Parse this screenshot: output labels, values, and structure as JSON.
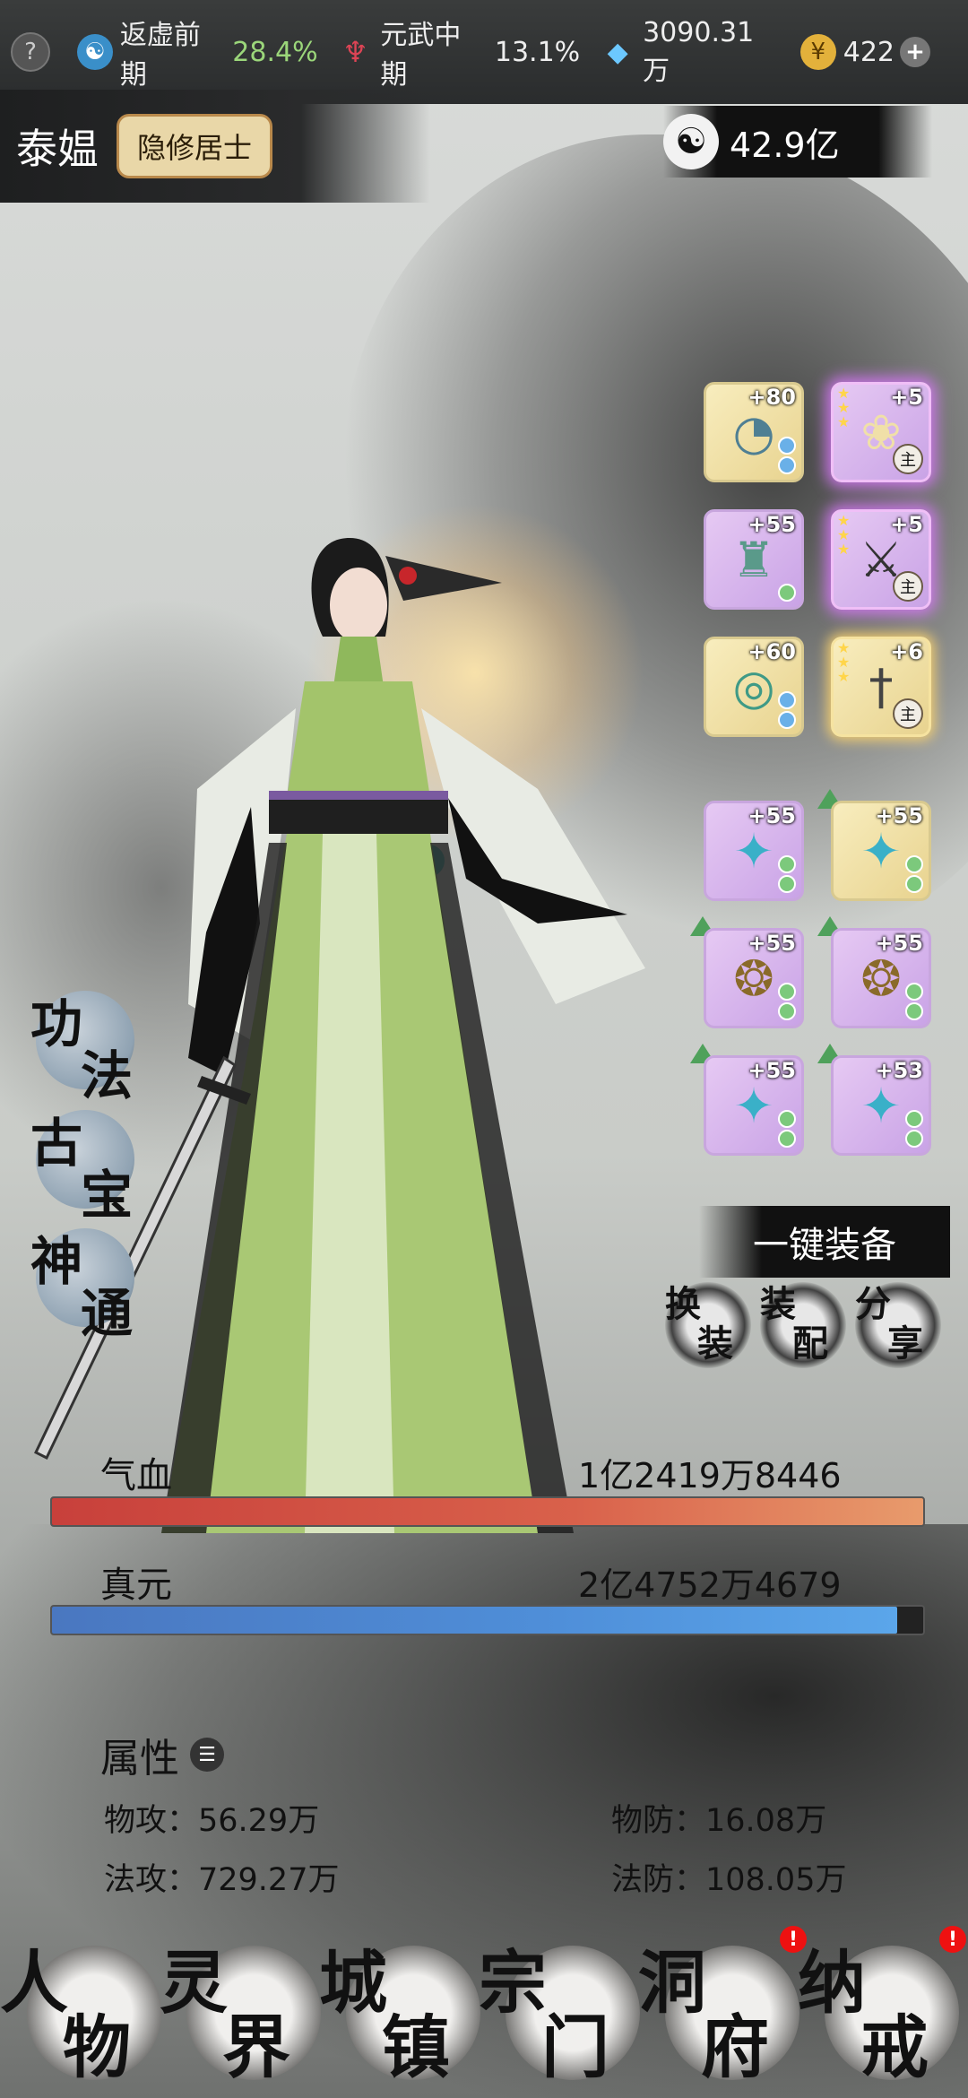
{
  "topbar": {
    "help": "?",
    "realm1": {
      "label": "返虚前期",
      "pct": "28.4%"
    },
    "realm2": {
      "label": "元武中期",
      "pct": "13.1%"
    },
    "spirit_stone": "3090.31万",
    "coins": "422"
  },
  "header": {
    "name": "泰媪",
    "title": "隐修居士",
    "power": "42.9亿"
  },
  "equipment": {
    "right_column_top": [
      {
        "level": "+80",
        "icon": "fan-icon",
        "type": "gold"
      },
      {
        "level": "+5",
        "icon": "lotus-icon",
        "type": "purple-main"
      },
      {
        "level": "+55",
        "icon": "robe-icon",
        "type": "purple"
      },
      {
        "level": "+5",
        "icon": "sword-icon",
        "type": "purple-main"
      },
      {
        "level": "+60",
        "icon": "jade-pendant-icon",
        "type": "gold"
      },
      {
        "level": "+6",
        "icon": "dagger-icon",
        "type": "gold-main"
      }
    ],
    "right_column_bottom": [
      {
        "level": "+55",
        "icon": "scroll-icon"
      },
      {
        "level": "+55",
        "icon": "scroll-icon"
      },
      {
        "level": "+55",
        "icon": "mirror-icon"
      },
      {
        "level": "+55",
        "icon": "mirror-icon"
      },
      {
        "level": "+55",
        "icon": "scroll-icon"
      },
      {
        "level": "+53",
        "icon": "scroll-icon"
      }
    ],
    "main_mark": "主"
  },
  "left_menu": [
    {
      "c1": "功",
      "c2": "法"
    },
    {
      "c1": "古",
      "c2": "宝"
    },
    {
      "c1": "神",
      "c2": "通"
    }
  ],
  "actions": {
    "one_key": "一键装备",
    "swap": {
      "c1": "换",
      "c2": "装"
    },
    "match": {
      "c1": "装",
      "c2": "配"
    },
    "share": {
      "c1": "分",
      "c2": "享"
    }
  },
  "stats": {
    "hp": {
      "label": "气血",
      "value": "1亿2419万8446",
      "fill_pct": 100
    },
    "mp": {
      "label": "真元",
      "value": "2亿4752万4679",
      "fill_pct": 97
    }
  },
  "attributes": {
    "title": "属性",
    "phys_atk": "物攻：56.29万",
    "phys_def": "物防：16.08万",
    "mag_atk": "法攻：729.27万",
    "mag_def": "法防：108.05万"
  },
  "nav": [
    {
      "c1": "人",
      "c2": "物",
      "badge": ""
    },
    {
      "c1": "灵",
      "c2": "界",
      "badge": ""
    },
    {
      "c1": "城",
      "c2": "镇",
      "badge": ""
    },
    {
      "c1": "宗",
      "c2": "门",
      "badge": ""
    },
    {
      "c1": "洞",
      "c2": "府",
      "badge": "!"
    },
    {
      "c1": "纳",
      "c2": "戒",
      "badge": "!"
    }
  ],
  "colors": {
    "hp": "#d9614b",
    "mp": "#4f8fd9",
    "accent_green": "#9bd67a"
  }
}
